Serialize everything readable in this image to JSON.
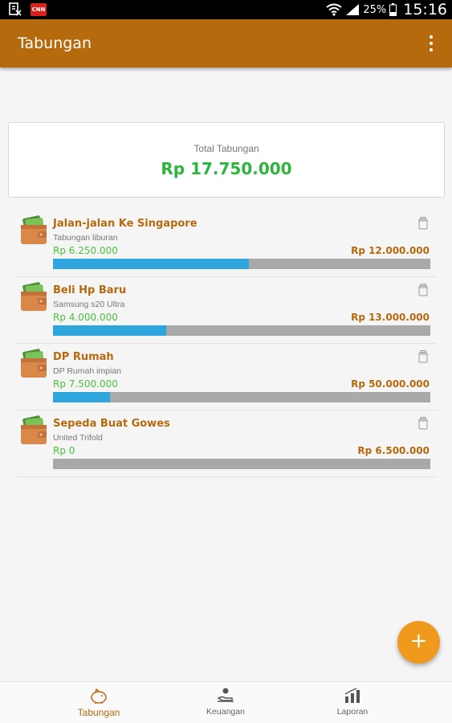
{
  "status_bar": {
    "icons": [
      "download-icon",
      "cnn-notification-icon",
      "wifi-icon",
      "signal-icon",
      "battery-icon"
    ],
    "cnn_badge": "CNN",
    "battery": "25%",
    "time": "15:16"
  },
  "app_bar": {
    "title": "Tabungan",
    "menu_icon": "overflow-menu-icon"
  },
  "summary": {
    "label": "Total Tabungan",
    "amount": "Rp 17.750.000"
  },
  "savings": [
    {
      "title": "Jalan-jalan Ke Singapore",
      "subtitle": "Tabungan liburan",
      "saved": "Rp 6.250.000",
      "target": "Rp 12.000.000",
      "progress": 0.52
    },
    {
      "title": "Beli Hp Baru",
      "subtitle": "Samsung s20 Ultra",
      "saved": "Rp 4.000.000",
      "target": "Rp 13.000.000",
      "progress": 0.3
    },
    {
      "title": "DP Rumah",
      "subtitle": "DP Rumah impian",
      "saved": "Rp 7.500.000",
      "target": "Rp 50.000.000",
      "progress": 0.15
    },
    {
      "title": "Sepeda Buat Gowes",
      "subtitle": "United Trifold",
      "saved": "Rp 0",
      "target": "Rp 6.500.000",
      "progress": 0
    }
  ],
  "fab": {
    "label": "+",
    "icon": "add-icon"
  },
  "bottom_nav": [
    {
      "label": "Tabungan",
      "icon": "piggy-bank-icon",
      "active": true
    },
    {
      "label": "Keuangan",
      "icon": "money-hand-icon",
      "active": false
    },
    {
      "label": "Laporan",
      "icon": "bar-chart-icon",
      "active": false
    }
  ],
  "colors": {
    "primary": "#b56a0e",
    "accent": "#f09a1d",
    "saved_green": "#4bbf3d",
    "total_green": "#2db43a",
    "progress_blue": "#2ea6dd",
    "progress_track": "#a9a9a9"
  }
}
